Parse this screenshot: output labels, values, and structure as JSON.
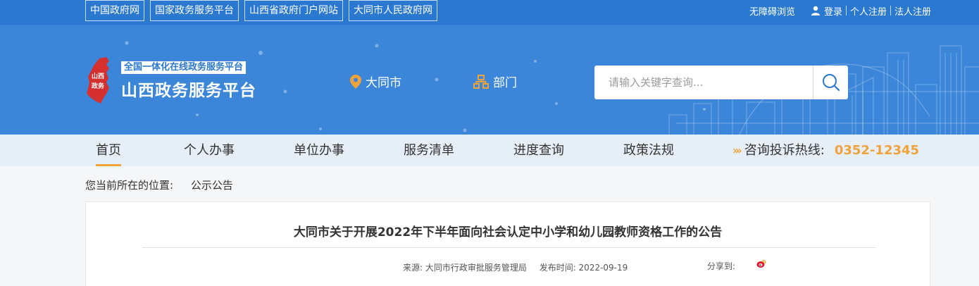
{
  "top_links": [
    "中国政府网",
    "国家政务服务平台",
    "山西省政府门户网站",
    "大同市人民政府网"
  ],
  "top_right": {
    "accessibility": "无障碍浏览",
    "login": "登录",
    "personal_register": "个人注册",
    "corp_register": "法人注册"
  },
  "header": {
    "logo_text": "山西政务",
    "slogan": "全国一体化在线政务服务平台",
    "title": "山西政务服务平台",
    "city": "大同市",
    "department": "部门",
    "search_placeholder": "请输入关键字查询..."
  },
  "nav": {
    "items": [
      "首页",
      "个人办事",
      "单位办事",
      "服务清单",
      "进度查询",
      "政策法规"
    ],
    "active_index": 0,
    "hotline_label": "咨询投诉热线:",
    "hotline_number": "0352-12345"
  },
  "breadcrumb": {
    "label": "您当前所在的位置:",
    "current": "公示公告"
  },
  "article": {
    "title": "大同市关于开展2022年下半年面向社会认定中小学和幼儿园教师资格工作的公告",
    "source": "来源: 大同市行政审批服务管理局",
    "date": "发布时间: 2022-09-19",
    "share_label": "分享到:"
  },
  "colors": {
    "topbar": "#2a78cf",
    "banner": "#3b86d8",
    "nav_bg": "#e6eef7",
    "accent_orange": "#f1a33b"
  }
}
